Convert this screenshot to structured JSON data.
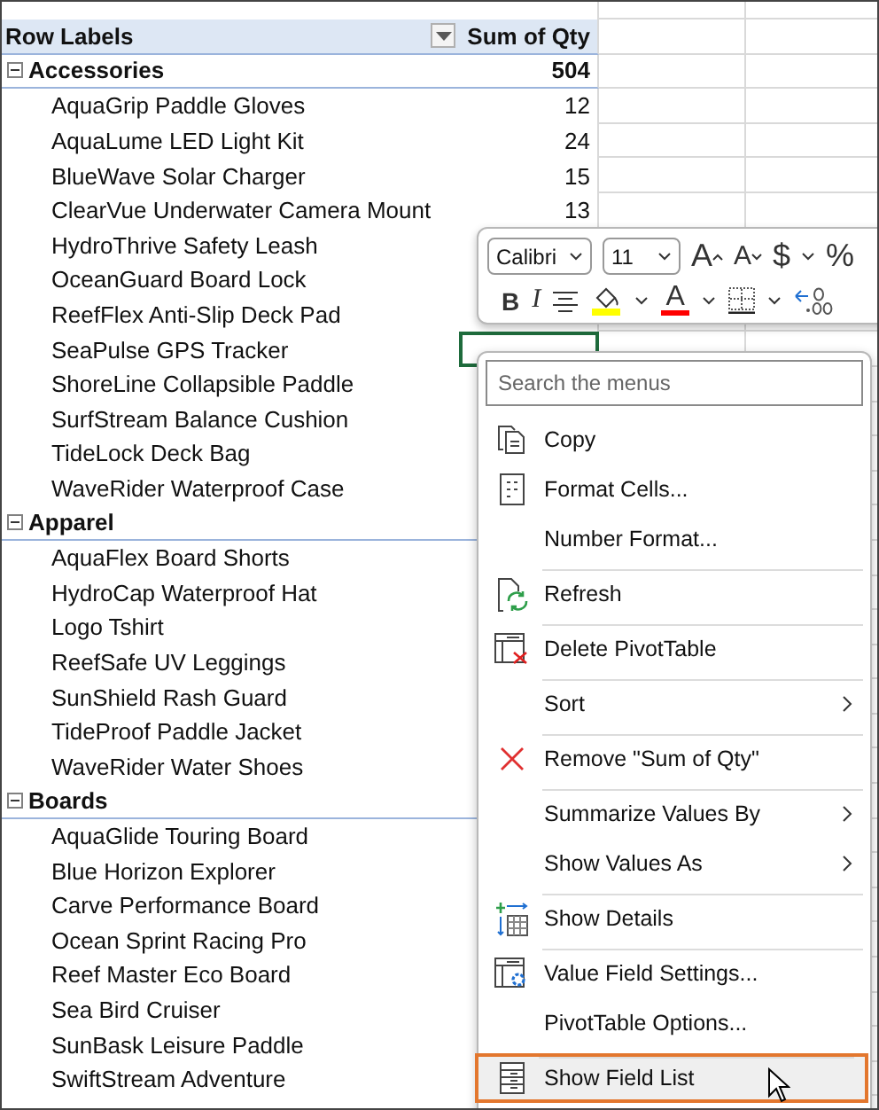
{
  "sheet": {
    "columns": [
      "Row Labels",
      "Sum of Qty"
    ],
    "groups": [
      {
        "label": "Accessories",
        "total": "504",
        "expanded": true,
        "items": [
          {
            "label": "AquaGrip Paddle Gloves",
            "value": "12",
            "selected": false
          },
          {
            "label": "AquaLume LED Light Kit",
            "value": "24",
            "selected": false
          },
          {
            "label": "BlueWave Solar Charger",
            "value": "15",
            "selected": false
          },
          {
            "label": "ClearVue Underwater Camera Mount",
            "value": "13",
            "selected": false
          },
          {
            "label": "HydroThrive Safety Leash",
            "selected": false
          },
          {
            "label": "OceanGuard Board Lock",
            "selected": false
          },
          {
            "label": "ReefFlex Anti-Slip Deck Pad",
            "selected": false
          },
          {
            "label": "SeaPulse GPS Tracker",
            "selected": true
          },
          {
            "label": "ShoreLine Collapsible Paddle",
            "selected": false
          },
          {
            "label": "SurfStream Balance Cushion",
            "selected": false
          },
          {
            "label": "TideLock Deck Bag",
            "selected": false
          },
          {
            "label": "WaveRider Waterproof Case",
            "selected": false
          }
        ]
      },
      {
        "label": "Apparel",
        "expanded": true,
        "items": [
          {
            "label": "AquaFlex Board Shorts",
            "selected": false
          },
          {
            "label": "HydroCap Waterproof Hat",
            "selected": false
          },
          {
            "label": "Logo Tshirt",
            "selected": false
          },
          {
            "label": "ReefSafe UV Leggings",
            "selected": false
          },
          {
            "label": "SunShield Rash Guard",
            "selected": false
          },
          {
            "label": "TideProof Paddle Jacket",
            "selected": false
          },
          {
            "label": "WaveRider Water Shoes",
            "selected": false
          }
        ]
      },
      {
        "label": "Boards",
        "expanded": true,
        "items": [
          {
            "label": "AquaGlide Touring Board",
            "selected": false
          },
          {
            "label": "Blue Horizon Explorer",
            "selected": false
          },
          {
            "label": "Carve Performance Board",
            "selected": false
          },
          {
            "label": "Ocean Sprint Racing Pro",
            "selected": false
          },
          {
            "label": "Reef Master Eco Board",
            "selected": false
          },
          {
            "label": "Sea Bird Cruiser",
            "selected": false
          },
          {
            "label": "SunBask Leisure Paddle",
            "selected": false
          },
          {
            "label": "SwiftStream Adventure",
            "selected": false
          }
        ]
      }
    ]
  },
  "mini_toolbar": {
    "font": "Calibri",
    "size": "11",
    "row1": [
      {
        "kind": "grow",
        "text": "A"
      },
      {
        "kind": "shrink",
        "text": "A"
      },
      {
        "kind": "text",
        "text": "$"
      },
      {
        "kind": "caret"
      },
      {
        "kind": "text",
        "text": "%"
      }
    ],
    "row2": [
      {
        "kind": "bold",
        "text": "B"
      },
      {
        "kind": "italic",
        "text": "I"
      },
      {
        "kind": "align"
      },
      {
        "kind": "fill",
        "color": "#ffff00"
      },
      {
        "kind": "caret"
      },
      {
        "kind": "fontcolor",
        "text": "A",
        "color": "#ff0000"
      },
      {
        "kind": "caret"
      },
      {
        "kind": "border"
      },
      {
        "kind": "caret"
      },
      {
        "kind": "decimal"
      }
    ]
  },
  "context_menu": {
    "search": {
      "placeholder": "Search the menus"
    },
    "items": [
      {
        "label": "Copy",
        "kind": "copy",
        "separator": false,
        "submenu": false,
        "selected": false
      },
      {
        "label": "Format Cells...",
        "kind": "format",
        "separator": false,
        "submenu": false,
        "selected": false
      },
      {
        "label": "Number Format...",
        "separator": false,
        "submenu": false,
        "selected": false
      },
      {
        "label": "Refresh",
        "kind": "refresh",
        "separator": true,
        "submenu": false,
        "selected": false
      },
      {
        "label": "Delete PivotTable",
        "kind": "delete",
        "separator": true,
        "submenu": false,
        "selected": false
      },
      {
        "label": "Sort",
        "separator": true,
        "submenu": true,
        "selected": false
      },
      {
        "label": "Remove \"Sum of Qty\"",
        "kind": "remove",
        "separator": true,
        "submenu": false,
        "selected": false
      },
      {
        "label": "Summarize Values By",
        "separator": true,
        "submenu": true,
        "selected": false
      },
      {
        "label": "Show Values As",
        "separator": false,
        "submenu": true,
        "selected": false
      },
      {
        "label": "Show Details",
        "kind": "details",
        "separator": true,
        "submenu": false,
        "selected": false
      },
      {
        "label": "Value Field Settings...",
        "kind": "settings",
        "separator": true,
        "submenu": false,
        "selected": false
      },
      {
        "label": "PivotTable Options...",
        "separator": false,
        "submenu": false,
        "selected": false
      },
      {
        "label": "Show Field List",
        "kind": "fieldlist",
        "separator": true,
        "submenu": false,
        "selected": true
      }
    ]
  }
}
